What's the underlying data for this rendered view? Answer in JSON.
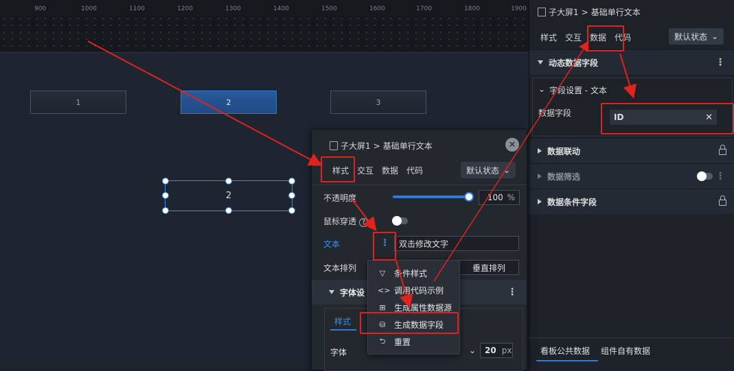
{
  "ruler": {
    "ticks": [
      "900",
      "1000",
      "1100",
      "1200",
      "1300",
      "1400",
      "1500",
      "1600",
      "1700",
      "1800",
      "1900"
    ]
  },
  "canvas": {
    "tabs": [
      "1",
      "2",
      "3"
    ],
    "selected_text": "2"
  },
  "right_panel": {
    "breadcrumb": {
      "parent": "子大屏1",
      "separator": ">",
      "current": "基础单行文本"
    },
    "tabs": [
      "样式",
      "交互",
      "数据",
      "代码"
    ],
    "state": "默认状态",
    "sections": {
      "dynamic_fields": "动态数据字段",
      "field_settings": "字段设置 - 文本",
      "data_field_label": "数据字段",
      "data_field_value": "ID",
      "linkage": "数据联动",
      "filter": "数据筛选",
      "conditional": "数据条件字段"
    },
    "bottom_tabs": [
      "看板公共数据",
      "组件自有数据"
    ]
  },
  "float_panel": {
    "breadcrumb": {
      "parent": "子大屏1",
      "separator": ">",
      "current": "基础单行文本"
    },
    "tabs": [
      "样式",
      "交互",
      "数据",
      "代码"
    ],
    "state": "默认状态",
    "opacity_label": "不透明度",
    "opacity_value": "100",
    "opacity_unit": "%",
    "opacity_percent": 100,
    "mouse_label": "鼠标穿透",
    "text_label": "文本",
    "text_value": "双击修改文字",
    "arrange_label": "文本排列",
    "arrange_option": "垂直排列",
    "font_section": "字体设",
    "font_tab": "样式",
    "font_label": "字体",
    "font_size": "20",
    "font_unit": "px"
  },
  "context_menu": {
    "items": [
      "条件样式",
      "调用代码示例",
      "生成属性数据源",
      "生成数据字段",
      "重置"
    ]
  },
  "colors": {
    "accent": "#2b7be0",
    "highlight": "#e0231c"
  }
}
